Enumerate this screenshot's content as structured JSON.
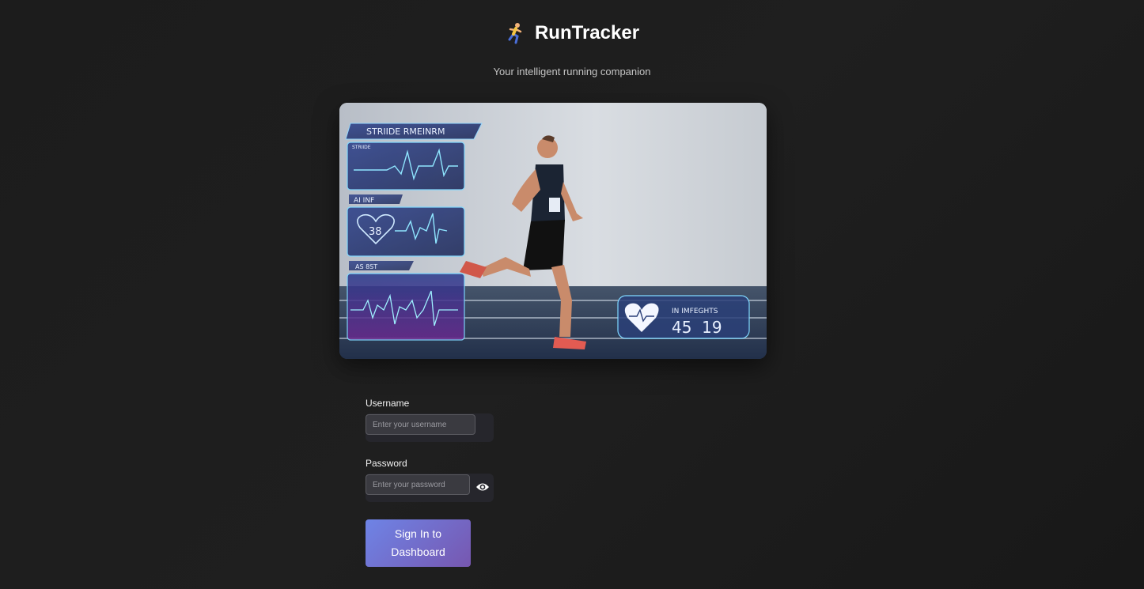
{
  "app": {
    "title": "RunTracker",
    "subtitle": "Your intelligent running companion",
    "logo_icon": "runner-icon"
  },
  "hero": {
    "hud_top_label": "STRIIDE RMEINRM",
    "hud_small_label": "STRIIDE",
    "hud_ai_label": "AI INF",
    "hud_heart_value": "38",
    "hud_as_label": "AS 8ST",
    "hud_right_label": "IN IMFEGHTS",
    "hud_right_value": "45  19"
  },
  "form": {
    "username_label": "Username",
    "username_placeholder": "Enter your username",
    "password_label": "Password",
    "password_placeholder": "Enter your password",
    "toggle_icon": "eye-icon",
    "submit_label": "Sign In to Dashboard"
  },
  "colors": {
    "background": "#1c1c1c",
    "button_start": "#6e84e6",
    "button_end": "#7757b0",
    "hud_cyan": "#7fd8ff"
  }
}
